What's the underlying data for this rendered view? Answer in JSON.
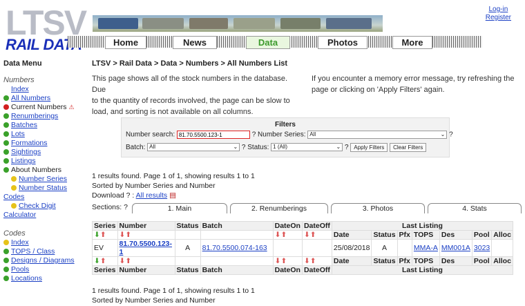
{
  "header": {
    "logo_top": "LTSV",
    "logo_bottom": "RAIL DATA",
    "nav": [
      "Home",
      "News",
      "Data",
      "Photos",
      "More"
    ],
    "active_nav": "Data",
    "login": "Log-in",
    "register": "Register"
  },
  "sidebar": {
    "title": "Data Menu",
    "numbers_heading": "Numbers",
    "numbers_items": [
      {
        "label": "Index"
      },
      {
        "label": "All Numbers"
      },
      {
        "label": "Current Numbers"
      },
      {
        "label": "Renumberings"
      },
      {
        "label": "Batches"
      },
      {
        "label": "Lots"
      },
      {
        "label": "Formations"
      },
      {
        "label": "Sightings"
      },
      {
        "label": "Listings"
      },
      {
        "label": "About Numbers"
      },
      {
        "label": "Number Series"
      },
      {
        "label": "Number Status"
      }
    ],
    "codes_label": "Codes",
    "check_digit": "Check Digit",
    "calculator": "Calculator",
    "codes_heading": "Codes",
    "codes_items": [
      {
        "label": "Index"
      },
      {
        "label": "TOPS / Class"
      },
      {
        "label": "Designs / Diagrams"
      },
      {
        "label": "Pools"
      },
      {
        "label": "Locations"
      }
    ]
  },
  "main": {
    "breadcrumb": "LTSV > Rail Data > Data > Numbers > All Numbers List",
    "intro_left_1": "This page shows all of the stock numbers in the database. Due",
    "intro_left_2": "to the quantity of records involved, the page can be slow to",
    "intro_left_3": "load, and sorting is not available on all columns.",
    "intro_right_1": "If you encounter a memory error message, try refreshing the",
    "intro_right_2": "page or clicking on 'Apply Filters' again.",
    "filters": {
      "title": "Filters",
      "number_search_label": "Number search:",
      "number_search_value": "81.70.5500.123-1",
      "number_series_label": "? Number Series:",
      "number_series_value": "All",
      "batch_label": "Batch:",
      "batch_value": "All",
      "status_label": "? Status:",
      "status_value": "1 (All)",
      "apply": "Apply Filters",
      "clear": "Clear Filters",
      "q": "?"
    },
    "results_line": "1 results found. Page 1 of 1, showing results 1 to 1",
    "sorted_line": "Sorted by Number Series and Number",
    "download_label": "Download ? :",
    "download_link": "All results",
    "sections_label": "Sections: ?",
    "section_tabs": [
      "1. Main",
      "2. Renumberings",
      "3. Photos",
      "4. Stats"
    ],
    "table": {
      "headers": [
        "Series",
        "Number",
        "Status",
        "Batch",
        "DateOn",
        "DateOff"
      ],
      "last_listing": "Last Listing",
      "sub_headers": [
        "Date",
        "Status",
        "Pfx",
        "TOPS",
        "Des",
        "Pool",
        "Alloc"
      ],
      "row": {
        "series": "EV",
        "number": "81.70.5500.123-1",
        "status": "A",
        "batch": "81.70.5500.074-163",
        "date": "25/08/2018",
        "ll_status": "A",
        "tops": "MMA-A",
        "des": "MM001A",
        "pool": "3023"
      }
    },
    "foot_results": "1 results found. Page 1 of 1, showing results 1 to 1",
    "foot_sorted": "Sorted by Number Series and Number"
  }
}
